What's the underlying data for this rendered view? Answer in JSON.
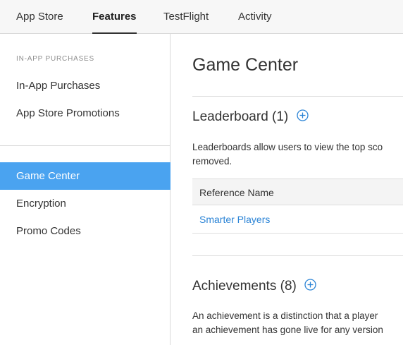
{
  "top_tabs": [
    {
      "label": "App Store",
      "active": false
    },
    {
      "label": "Features",
      "active": true
    },
    {
      "label": "TestFlight",
      "active": false
    },
    {
      "label": "Activity",
      "active": false
    }
  ],
  "sidebar": {
    "heading": "IN-APP PURCHASES",
    "group1": [
      {
        "label": "In-App Purchases"
      },
      {
        "label": "App Store Promotions"
      }
    ],
    "group2": [
      {
        "label": "Game Center",
        "selected": true
      },
      {
        "label": "Encryption"
      },
      {
        "label": "Promo Codes"
      }
    ]
  },
  "main": {
    "title": "Game Center",
    "leaderboard": {
      "title": "Leaderboard (1)",
      "desc_line1": "Leaderboards allow users to view the top sco",
      "desc_line2": "removed.",
      "table_header": "Reference Name",
      "rows": [
        {
          "name": "Smarter Players"
        }
      ]
    },
    "achievements": {
      "title": "Achievements (8)",
      "desc_line1": "An achievement is a distinction that a player",
      "desc_line2": "an achievement has gone live for any version"
    }
  },
  "colors": {
    "accent": "#4aa3f0",
    "link": "#2b84d6",
    "plus_icon": "#2b84d6"
  },
  "icons": [
    "plus-circle-icon"
  ]
}
